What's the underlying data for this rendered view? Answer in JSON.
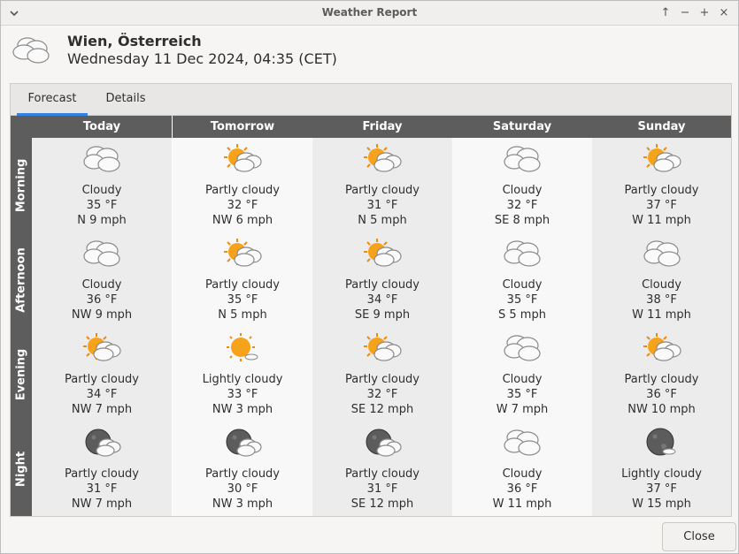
{
  "window": {
    "title": "Weather Report"
  },
  "header": {
    "location": "Wien, Österreich",
    "datetime": "Wednesday 11 Dec 2024, 04:35 (CET)",
    "icon": "cloudy-icon"
  },
  "tabs": [
    {
      "label": "Forecast",
      "active": true
    },
    {
      "label": "Details",
      "active": false
    }
  ],
  "days": [
    "Today",
    "Tomorrow",
    "Friday",
    "Saturday",
    "Sunday"
  ],
  "periods": [
    "Morning",
    "Afternoon",
    "Evening",
    "Night"
  ],
  "forecast": [
    [
      {
        "cond": "Cloudy",
        "temp": "35 °F",
        "wind": "N 9 mph",
        "icon": "cloudy-icon"
      },
      {
        "cond": "Partly cloudy",
        "temp": "32 °F",
        "wind": "NW 6 mph",
        "icon": "partly-cloudy-day-icon"
      },
      {
        "cond": "Partly cloudy",
        "temp": "31 °F",
        "wind": "N 5 mph",
        "icon": "partly-cloudy-day-icon"
      },
      {
        "cond": "Cloudy",
        "temp": "32 °F",
        "wind": "SE 8 mph",
        "icon": "cloudy-icon"
      },
      {
        "cond": "Partly cloudy",
        "temp": "37 °F",
        "wind": "W 11 mph",
        "icon": "partly-cloudy-day-icon"
      }
    ],
    [
      {
        "cond": "Cloudy",
        "temp": "36 °F",
        "wind": "NW 9 mph",
        "icon": "cloudy-icon"
      },
      {
        "cond": "Partly cloudy",
        "temp": "35 °F",
        "wind": "N 5 mph",
        "icon": "partly-cloudy-day-icon"
      },
      {
        "cond": "Partly cloudy",
        "temp": "34 °F",
        "wind": "SE 9 mph",
        "icon": "partly-cloudy-day-icon"
      },
      {
        "cond": "Cloudy",
        "temp": "35 °F",
        "wind": "S 5 mph",
        "icon": "cloudy-icon"
      },
      {
        "cond": "Cloudy",
        "temp": "38 °F",
        "wind": "W 11 mph",
        "icon": "cloudy-icon"
      }
    ],
    [
      {
        "cond": "Partly cloudy",
        "temp": "34 °F",
        "wind": "NW 7 mph",
        "icon": "partly-cloudy-day-icon"
      },
      {
        "cond": "Lightly cloudy",
        "temp": "33 °F",
        "wind": "NW 3 mph",
        "icon": "lightly-cloudy-day-icon"
      },
      {
        "cond": "Partly cloudy",
        "temp": "32 °F",
        "wind": "SE 12 mph",
        "icon": "partly-cloudy-day-icon"
      },
      {
        "cond": "Cloudy",
        "temp": "35 °F",
        "wind": "W 7 mph",
        "icon": "cloudy-icon"
      },
      {
        "cond": "Partly cloudy",
        "temp": "36 °F",
        "wind": "NW 10 mph",
        "icon": "partly-cloudy-day-icon"
      }
    ],
    [
      {
        "cond": "Partly cloudy",
        "temp": "31 °F",
        "wind": "NW 7 mph",
        "icon": "partly-cloudy-night-icon"
      },
      {
        "cond": "Partly cloudy",
        "temp": "30 °F",
        "wind": "NW 3 mph",
        "icon": "partly-cloudy-night-icon"
      },
      {
        "cond": "Partly cloudy",
        "temp": "31 °F",
        "wind": "SE 12 mph",
        "icon": "partly-cloudy-night-icon"
      },
      {
        "cond": "Cloudy",
        "temp": "36 °F",
        "wind": "W 11 mph",
        "icon": "cloudy-icon"
      },
      {
        "cond": "Lightly cloudy",
        "temp": "37 °F",
        "wind": "W 15 mph",
        "icon": "lightly-cloudy-night-icon"
      }
    ]
  ],
  "buttons": {
    "close_label": "Close"
  },
  "colors": {
    "header_bg": "#5d5d5d",
    "tab_accent": "#3584e4",
    "sun": "#f7a21b",
    "moon": "#5c5c5c"
  }
}
